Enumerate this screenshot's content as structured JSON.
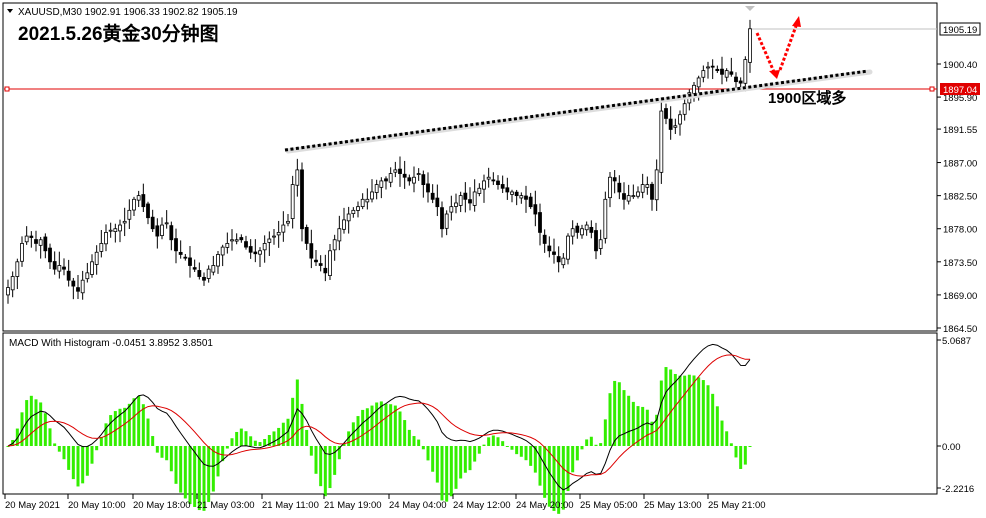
{
  "header": {
    "symbol_line": "XAUUSD,M30  1902.91 1906.33 1902.82 1905.19",
    "chart_title": "2021.5.26黄金30分钟图"
  },
  "annotation": {
    "label": "1900区域多"
  },
  "price_axis": {
    "ticks": [
      "1900.40",
      "1895.90",
      "1891.55",
      "1887.00",
      "1882.50",
      "1878.00",
      "1873.50",
      "1869.00",
      "1864.50"
    ],
    "current_price": "1905.19",
    "line_price": "1897.04"
  },
  "macd": {
    "title": "MACD With Histogram -0.0451 3.8952 3.8501",
    "ticks": [
      "5.0687",
      "0.00",
      "-2.2216"
    ]
  },
  "time_axis": {
    "labels": [
      "20 May 2021",
      "20 May 10:00",
      "20 May 18:00",
      "21 May 03:00",
      "21 May 11:00",
      "21 May 19:00",
      "24 May 04:00",
      "24 May 12:00",
      "24 May 20:00",
      "25 May 05:00",
      "25 May 13:00",
      "25 May 21:00"
    ]
  },
  "colors": {
    "bullish_candle": "#ffffff",
    "bearish_candle": "#000000",
    "horizontal_line": "#e00000",
    "histogram": "#33ee00",
    "signal_line": "#dd0000",
    "macd_line": "#000000",
    "arrow": "#ff0000"
  },
  "chart_data": {
    "type": "candlestick",
    "title": "2021.5.26黄金30分钟图",
    "symbol": "XAUUSD",
    "timeframe": "M30",
    "last_bar": {
      "open": 1902.91,
      "high": 1906.33,
      "low": 1902.82,
      "close": 1905.19
    },
    "ylim": [
      1864.5,
      1908.0
    ],
    "horizontal_line": 1897.04,
    "closes": [
      1870.0,
      1871.5,
      1873.5,
      1876.0,
      1877.0,
      1876.8,
      1876.0,
      1876.5,
      1875.0,
      1873.5,
      1872.5,
      1873.0,
      1872.5,
      1871.0,
      1870.2,
      1869.5,
      1871.0,
      1872.0,
      1873.5,
      1874.8,
      1876.0,
      1877.5,
      1877.8,
      1878.0,
      1878.5,
      1879.0,
      1880.5,
      1882.0,
      1882.5,
      1881.0,
      1879.5,
      1878.0,
      1877.0,
      1878.5,
      1878.8,
      1876.5,
      1875.0,
      1874.5,
      1874.0,
      1873.0,
      1872.5,
      1871.5,
      1871.0,
      1872.5,
      1873.0,
      1874.5,
      1875.5,
      1876.0,
      1876.5,
      1876.5,
      1876.5,
      1875.5,
      1874.8,
      1874.6,
      1875.0,
      1876.0,
      1876.6,
      1877.0,
      1877.5,
      1878.5,
      1879.0,
      1884.0,
      1886.0,
      1878.0,
      1876.0,
      1874.0,
      1873.5,
      1873.0,
      1872.0,
      1875.0,
      1876.5,
      1878.0,
      1879.2,
      1880.0,
      1880.5,
      1881.0,
      1882.0,
      1882.0,
      1883.0,
      1884.0,
      1884.5,
      1884.5,
      1885.5,
      1886.0,
      1885.5,
      1885.0,
      1884.5,
      1885.0,
      1885.5,
      1884.0,
      1883.0,
      1882.0,
      1881.0,
      1878.0,
      1880.0,
      1881.0,
      1881.5,
      1882.5,
      1882.0,
      1881.5,
      1883.0,
      1883.5,
      1884.5,
      1885.0,
      1884.5,
      1884.0,
      1883.5,
      1883.0,
      1883.0,
      1882.5,
      1882.5,
      1882.0,
      1881.0,
      1880.0,
      1877.5,
      1876.0,
      1875.0,
      1874.5,
      1873.5,
      1874.0,
      1877.0,
      1878.0,
      1877.5,
      1878.0,
      1878.5,
      1877.5,
      1875.0,
      1876.5,
      1882.0,
      1885.0,
      1884.5,
      1883.0,
      1882.0,
      1882.5,
      1882.5,
      1883.0,
      1884.0,
      1884.0,
      1882.0,
      1886.0,
      1894.0,
      1893.0,
      1891.5,
      1892.0,
      1893.5,
      1895.0,
      1896.5,
      1897.5,
      1898.5,
      1899.5,
      1900.0,
      1900.0,
      1899.5,
      1899.0,
      1899.5,
      1899.0,
      1898.0,
      1897.8,
      1901.0,
      1905.19
    ],
    "macd_range": [
      -2.2216,
      5.0687
    ]
  }
}
